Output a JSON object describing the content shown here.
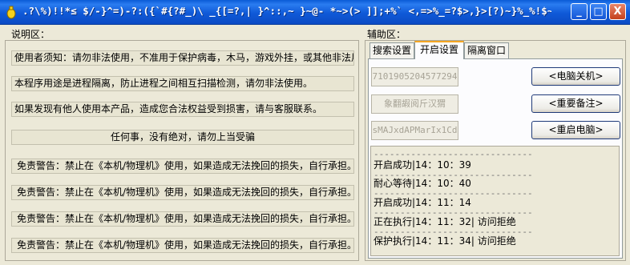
{
  "window": {
    "title": ".?\\%)!!*≤ $/-}^=)-?:({`#{?#_)\\ _{[=?,| }^::,~ }~@- *~>(> ]];+%` <,=>%_=?$>,}>[?)~}%_%!$~_-`\\|,^~",
    "controls": {
      "minimize": "_",
      "maximize": "□",
      "close": "X"
    }
  },
  "left": {
    "label": "说明区：",
    "notices": [
      "使用者须知：请勿非法使用，不准用于保护病毒，木马，游戏外挂，或其他非法用途",
      "本程序用途是进程隔离，防止进程之间相互扫描检测，请勿非法使用。",
      "如果发现有他人使用本产品，造成您合法权益受到损害，请与客服联系。",
      "任何事，没有绝对，请勿上当受骗",
      "免责警告：禁止在《本机/物理机》使用，如果造成无法挽回的损失，自行承担。",
      "免责警告：禁止在《本机/物理机》使用，如果造成无法挽回的损失，自行承担。",
      "免责警告：禁止在《本机/物理机》使用，如果造成无法挽回的损失，自行承担。",
      "免责警告：禁止在《本机/物理机》使用，如果造成无法挽回的损失，自行承担。"
    ]
  },
  "right": {
    "label": "辅助区：",
    "tabs": [
      "搜索设置",
      "开启设置",
      "隔离窗口"
    ],
    "active_tab": "开启设置",
    "fields": [
      "7101905204577294",
      "象翻嘏阅斤汉猬",
      "sMAJxdAPMarIx1Cd"
    ],
    "buttons": [
      "<电脑关机>",
      "<重要备注>",
      "<重启电脑>"
    ],
    "log": {
      "separator": "------------------------------",
      "lines": [
        "开启成功|14：10：39",
        "耐心等待|14：10：40",
        "开启成功|14：11：14",
        "正在执行|14：11：32| 访问拒绝",
        "保护执行|14：11：34| 访问拒绝"
      ]
    }
  },
  "colors": {
    "face": "#ECE9D8",
    "titlebar": "#0B4BC4",
    "tab_highlight": "#F5A623",
    "close_button": "#C4401C"
  }
}
